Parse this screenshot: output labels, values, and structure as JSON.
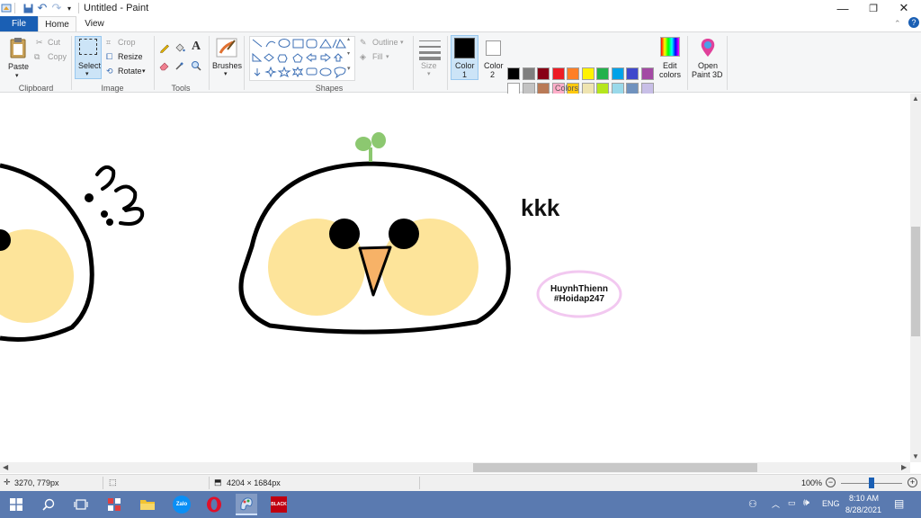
{
  "window": {
    "title": "Untitled - Paint",
    "minimize": "—",
    "restore": "❐",
    "close": "✕"
  },
  "tabs": {
    "file": "File",
    "home": "Home",
    "view": "View",
    "help": "?"
  },
  "ribbon": {
    "clipboard": {
      "label": "Clipboard",
      "paste": "Paste",
      "cut": "Cut",
      "copy": "Copy"
    },
    "image": {
      "label": "Image",
      "select": "Select",
      "crop": "Crop",
      "resize": "Resize",
      "rotate": "Rotate"
    },
    "tools": {
      "label": "Tools"
    },
    "brushes": {
      "label": "Brushes"
    },
    "shapes": {
      "label": "Shapes",
      "outline": "Outline",
      "fill": "Fill"
    },
    "size": {
      "label": "Size"
    },
    "colors": {
      "label": "Colors",
      "color1": "Color",
      "color1_num": "1",
      "color2": "Color",
      "color2_num": "2",
      "color1_value": "#000000",
      "color2_value": "#ffffff",
      "edit": "Edit",
      "edit2": "colors",
      "palette_row1": [
        "#000000",
        "#7f7f7f",
        "#880015",
        "#ed1c24",
        "#ff7f27",
        "#fff200",
        "#22b14c",
        "#00a2e8",
        "#3f48cc",
        "#a349a4"
      ],
      "palette_row2": [
        "#ffffff",
        "#c3c3c3",
        "#b97a57",
        "#ffaec9",
        "#ffc90e",
        "#efe4b0",
        "#b5e61d",
        "#99d9ea",
        "#7092be",
        "#c8bfe7"
      ],
      "palette_row3": [
        "#f7d27a",
        "#a6d67a",
        "#f4b8f0",
        "#f9c066",
        "#ffffff",
        "#ffffff",
        "#ffffff",
        "#ffffff",
        "#ffffff",
        "#ffffff"
      ]
    },
    "paint3d": {
      "line1": "Open",
      "line2": "Paint 3D"
    }
  },
  "canvas": {
    "text_kkk": "kkk",
    "sig_line1": "HuynhThienn",
    "sig_line2": "#Hoidap247"
  },
  "status": {
    "cursor_pos": "3270, 779px",
    "image_size": "4204 × 1684px",
    "zoom": "100%",
    "zoom_slider_fraction": 0.5
  },
  "taskbar": {
    "lang": "ENG",
    "time": "8:10 AM",
    "date": "8/28/2021",
    "zalo": "Zalo",
    "app_badge": "BLACK"
  }
}
